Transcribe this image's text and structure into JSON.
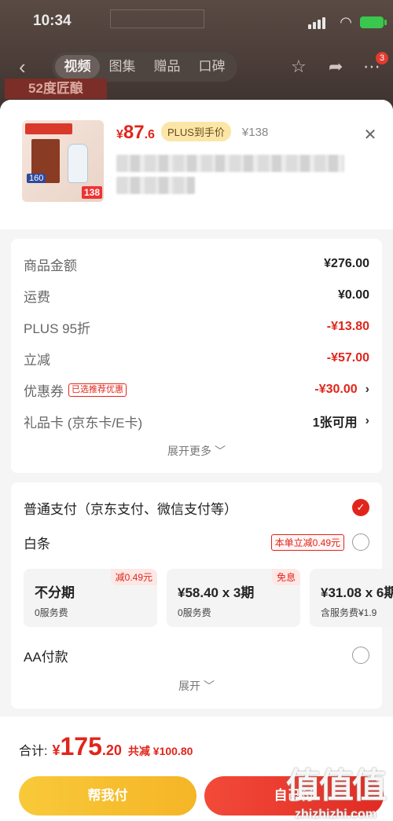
{
  "status_bar": {
    "time": "10:34"
  },
  "background_page": {
    "tabs": [
      "视频",
      "图集",
      "赠品",
      "口碑"
    ],
    "active_tab_index": 0,
    "cart_badge": "3",
    "promo_banner": "52度匠酿"
  },
  "product": {
    "price_symbol": "¥",
    "price_int": "87",
    "price_dec": ".6",
    "plus_tag": "PLUS到手价",
    "original_price": "¥138",
    "thumb_price": "138",
    "thumb_badge": "160"
  },
  "amounts": {
    "rows": [
      {
        "label": "商品金额",
        "value": "¥276.00",
        "style": "normal"
      },
      {
        "label": "运费",
        "value": "¥0.00",
        "style": "normal"
      },
      {
        "label": "PLUS 95折",
        "value": "-¥13.80",
        "style": "red"
      },
      {
        "label": "立减",
        "value": "-¥57.00",
        "style": "red"
      },
      {
        "label": "优惠券",
        "tag": "已选推荐优惠",
        "value": "-¥30.00",
        "style": "red",
        "chevron": true
      },
      {
        "label": "礼品卡 (京东卡/E卡)",
        "value": "1张可用",
        "style": "normal",
        "chevron": true
      }
    ],
    "expand_more": "展开更多"
  },
  "payment": {
    "normal_pay": "普通支付（京东支付、微信支付等）",
    "baitiao": "白条",
    "baitiao_discount": "本单立减0.49元",
    "plans": [
      {
        "title": "不分期",
        "sub": "0服务费",
        "corner": "减0.49元"
      },
      {
        "title": "¥58.40 x 3期",
        "sub": "0服务费",
        "corner": "免息"
      },
      {
        "title": "¥31.08 x 6期",
        "sub": "含服务费¥1.9",
        "corner": ""
      }
    ],
    "aa_pay": "AA付款",
    "expand": "展开"
  },
  "bottom": {
    "total_label": "合计:",
    "total_symbol": "¥",
    "total_int": "175",
    "total_dec": ".20",
    "saved": "共减 ¥100.80",
    "btn_help": "帮我付",
    "btn_self": "自己付",
    "watermark_site": "zhizhizhi.com",
    "watermark_logo": "值值值"
  },
  "colors": {
    "accent_red": "#e1251b",
    "help_yellow": "#f5b526",
    "plus_gold": "#fbe6a8"
  }
}
